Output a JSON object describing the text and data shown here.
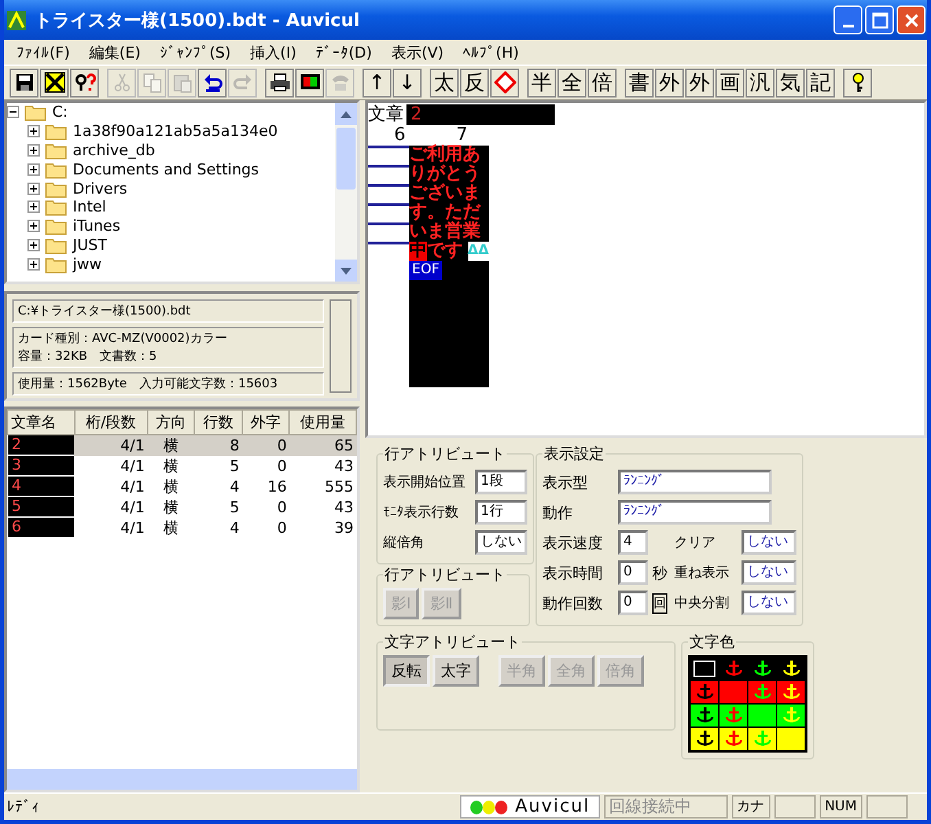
{
  "window": {
    "title": "トライスター様(1500).bdt - Auvicul"
  },
  "menu": [
    "ﾌｧｲﾙ(F)",
    "編集(E)",
    "ｼﾞｬﾝﾌﾟ(S)",
    "挿入(I)",
    "ﾃﾞｰﾀ(D)",
    "表示(V)",
    "ﾍﾙﾌﾟ(H)"
  ],
  "toolbar": [
    [
      {
        "kind": "icon",
        "disabled": false
      },
      {
        "kind": "icon",
        "disabled": false
      },
      {
        "kind": "icon",
        "disabled": false
      }
    ],
    [
      {
        "kind": "icon",
        "disabled": true
      },
      {
        "kind": "icon",
        "disabled": true
      },
      {
        "kind": "icon",
        "disabled": true
      },
      {
        "kind": "icon",
        "disabled": false
      },
      {
        "kind": "icon",
        "disabled": true
      }
    ],
    [
      {
        "kind": "icon",
        "disabled": false
      },
      {
        "kind": "icon",
        "disabled": false
      },
      {
        "kind": "icon",
        "disabled": true
      }
    ],
    [
      {
        "kind": "text",
        "label": "↑"
      },
      {
        "kind": "text",
        "label": "↓"
      }
    ],
    [
      {
        "kind": "text",
        "label": "太"
      },
      {
        "kind": "text",
        "label": "反"
      },
      {
        "kind": "icon",
        "disabled": false
      }
    ],
    [
      {
        "kind": "text",
        "label": "半"
      },
      {
        "kind": "text",
        "label": "全"
      },
      {
        "kind": "text",
        "label": "倍"
      }
    ],
    [
      {
        "kind": "text",
        "label": "書"
      },
      {
        "kind": "text",
        "label": "外"
      },
      {
        "kind": "text",
        "label": "外"
      },
      {
        "kind": "text",
        "label": "画"
      },
      {
        "kind": "text",
        "label": "汎"
      },
      {
        "kind": "text",
        "label": "気"
      },
      {
        "kind": "text",
        "label": "記"
      }
    ],
    [
      {
        "kind": "icon",
        "disabled": false
      }
    ]
  ],
  "tree": {
    "label": "C:",
    "expanded": true,
    "children": [
      {
        "label": "1a38f90a121ab5a5a134e0",
        "expanded": false
      },
      {
        "label": "archive_db",
        "expanded": false
      },
      {
        "label": "Documents and Settings",
        "expanded": false
      },
      {
        "label": "Drivers",
        "expanded": false
      },
      {
        "label": "Intel",
        "expanded": false
      },
      {
        "label": "iTunes",
        "expanded": false
      },
      {
        "label": "JUST",
        "expanded": false
      },
      {
        "label": "jww",
        "expanded": false
      }
    ]
  },
  "file_info": {
    "path": "C:¥トライスター様(1500).bdt",
    "card": [
      "カード種別：AVC-MZ(V0002)カラー",
      "容量：32KB　文書数：5"
    ],
    "usage": "使用量：1562Byte　入力可能文字数：15603"
  },
  "documents": {
    "columns": [
      "文章名",
      "桁/段数",
      "方向",
      "行数",
      "外字",
      "使用量"
    ],
    "rows": [
      {
        "name": "2",
        "digits": "4/1",
        "direction": "横",
        "lines": "8",
        "gaiji": "0",
        "usage": "65",
        "selected": true
      },
      {
        "name": "3",
        "digits": "4/1",
        "direction": "横",
        "lines": "5",
        "gaiji": "0",
        "usage": "43",
        "selected": false
      },
      {
        "name": "4",
        "digits": "4/1",
        "direction": "横",
        "lines": "4",
        "gaiji": "16",
        "usage": "555",
        "selected": false
      },
      {
        "name": "5",
        "digits": "4/1",
        "direction": "横",
        "lines": "5",
        "gaiji": "0",
        "usage": "43",
        "selected": false
      },
      {
        "name": "6",
        "digits": "4/1",
        "direction": "横",
        "lines": "4",
        "gaiji": "0",
        "usage": "39",
        "selected": false
      }
    ]
  },
  "editor": {
    "label": "文章",
    "doc": "2",
    "column_numbers": [
      "6",
      "7"
    ],
    "lines": [
      {
        "text": "ご利用あ"
      },
      {
        "text": "りがとう"
      },
      {
        "text": "ございま"
      },
      {
        "text": "す。ただ"
      },
      {
        "text": "いま営業"
      },
      {
        "text": "です",
        "cursor": "中"
      }
    ],
    "end_mark": "ΔΔ",
    "eof": "EOF"
  },
  "line_attributes": {
    "title": "行アトリビュート",
    "fields": [
      {
        "label": "表示開始位置",
        "value": "1段"
      },
      {
        "label": "ﾓﾆﾀ表示行数",
        "value": "1行"
      },
      {
        "label": "縦倍角",
        "value": "しない"
      }
    ]
  },
  "shadow": {
    "title": "行アトリビュート",
    "buttons": [
      {
        "label": "影Ⅰ",
        "disabled": true
      },
      {
        "label": "影Ⅱ",
        "disabled": true
      }
    ]
  },
  "display": {
    "title": "表示設定",
    "wide": [
      {
        "label": "表示型",
        "value": "ﾗﾝﾆﾝｸﾞ"
      },
      {
        "label": "動作",
        "value": "ﾗﾝﾆﾝｸﾞ"
      }
    ],
    "rows": [
      {
        "label": "表示速度",
        "value": "4",
        "label2": "クリア",
        "value2": "しない"
      },
      {
        "label": "表示時間",
        "value": "0",
        "unit": "秒",
        "unit_boxed": false,
        "label2": "重ね表示",
        "value2": "しない"
      },
      {
        "label": "動作回数",
        "value": "0",
        "unit": "回",
        "unit_boxed": true,
        "label2": "中央分割",
        "value2": "しない"
      }
    ]
  },
  "char_attributes": {
    "title": "文字アトリビュート",
    "groups": [
      [
        {
          "label": "反転",
          "pressed": true,
          "disabled": false
        },
        {
          "label": "太字",
          "pressed": false,
          "disabled": false
        }
      ],
      [
        {
          "label": "半角",
          "pressed": false,
          "disabled": true
        },
        {
          "label": "全角",
          "pressed": false,
          "disabled": true
        },
        {
          "label": "倍角",
          "pressed": false,
          "disabled": true
        }
      ]
    ]
  },
  "char_color": {
    "title": "文字色",
    "cells": [
      [
        {
          "color": "#000000",
          "selected": true
        },
        {
          "color": "#000000",
          "glyph": {
            "color": "#ff0000"
          },
          "selected": false
        },
        {
          "color": "#000000",
          "glyph": {
            "color": "#00ff00"
          },
          "selected": false
        },
        {
          "color": "#000000",
          "glyph": {
            "color": "#ffff00"
          },
          "selected": false
        }
      ],
      [
        {
          "color": "#ff0000",
          "glyph": {
            "color": "#000000"
          },
          "selected": false
        },
        {
          "color": "#ff0000",
          "selected": false
        },
        {
          "color": "#ff0000",
          "glyph": {
            "color": "#00ff00"
          },
          "selected": false
        },
        {
          "color": "#ff0000",
          "glyph": {
            "color": "#ffff00"
          },
          "selected": false
        }
      ],
      [
        {
          "color": "#00ff00",
          "glyph": {
            "color": "#000000"
          },
          "selected": false
        },
        {
          "color": "#00ff00",
          "glyph": {
            "color": "#ff0000"
          },
          "selected": false
        },
        {
          "color": "#00ff00",
          "selected": false
        },
        {
          "color": "#00ff00",
          "glyph": {
            "color": "#ffff00"
          },
          "selected": false
        }
      ],
      [
        {
          "color": "#ffff00",
          "glyph": {
            "color": "#000000"
          },
          "selected": false
        },
        {
          "color": "#ffff00",
          "glyph": {
            "color": "#ff0000"
          },
          "selected": false
        },
        {
          "color": "#ffff00",
          "glyph": {
            "color": "#00ff00"
          },
          "selected": false
        },
        {
          "color": "#ffff00",
          "selected": false
        }
      ]
    ]
  },
  "status_bar": {
    "text": "ﾚﾃﾞｨ",
    "logo": "Auvicul",
    "connection": {
      "label": "回線接続中",
      "disabled": true
    },
    "kana": "カナ",
    "num": "NUM"
  }
}
